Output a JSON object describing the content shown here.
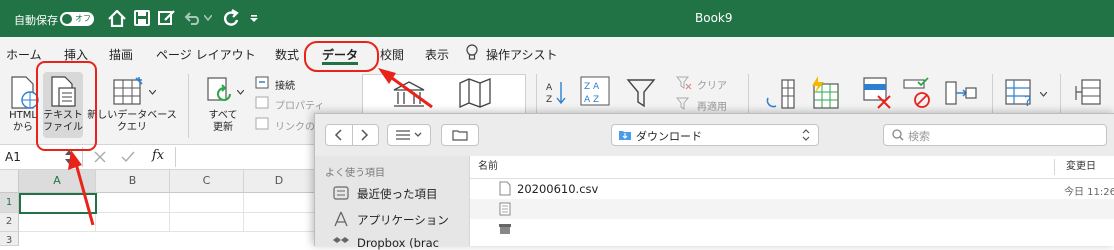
{
  "titlebar": {
    "autosave_label": "自動保存",
    "toggle_state": "オフ",
    "doc_title": "Book9",
    "bg_color": "#217346"
  },
  "tabs": [
    {
      "label": "ホーム"
    },
    {
      "label": "挿入"
    },
    {
      "label": "描画"
    },
    {
      "label": "ページ レイアウト"
    },
    {
      "label": "数式"
    },
    {
      "label": "データ"
    },
    {
      "label": "校閲"
    },
    {
      "label": "表示"
    },
    {
      "label": "操作アシスト"
    }
  ],
  "ribbon": {
    "html_label": [
      "HTML",
      "から"
    ],
    "text_file_label": [
      "テキスト",
      "ファイル"
    ],
    "new_db_query_label": [
      "新しいデータベース",
      "クエリ"
    ],
    "refresh_all_label": [
      "すべて",
      "更新"
    ],
    "connections": "接続",
    "properties": "プロパティ",
    "links": "リンクの",
    "clear": "クリア",
    "reapply": "再適用"
  },
  "formula_bar": {
    "name_box": "A1",
    "fx": "fx"
  },
  "grid": {
    "columns": [
      "A",
      "B",
      "C",
      "D"
    ],
    "rows": [
      "1",
      "2",
      "3"
    ]
  },
  "dialog": {
    "location": "ダウンロード",
    "search_placeholder": "検索",
    "sidebar_header": "よく使う項目",
    "sidebar_items": [
      "最近使った項目",
      "アプリケーション",
      "Dropbox (brac"
    ],
    "col_name": "名前",
    "col_modified": "変更日",
    "files": [
      {
        "name": "20200610.csv",
        "modified": "今日 11:26"
      }
    ]
  },
  "annotation_color": "#e8231a"
}
